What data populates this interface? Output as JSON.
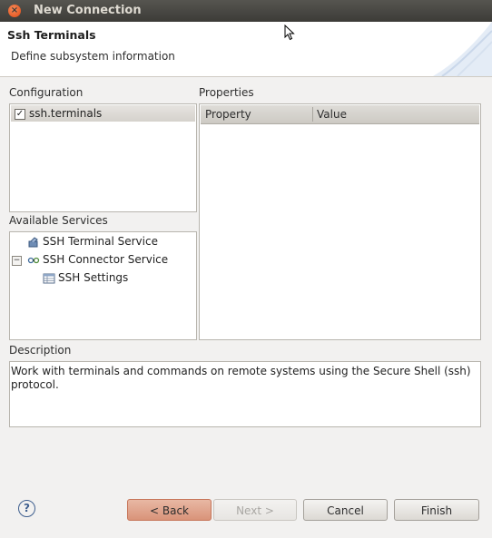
{
  "window": {
    "title": "New Connection"
  },
  "header": {
    "title": "Ssh Terminals",
    "subtitle": "Define subsystem information"
  },
  "configuration": {
    "label": "Configuration",
    "items": [
      {
        "label": "ssh.terminals",
        "checked": true
      }
    ]
  },
  "services": {
    "label": "Available Services",
    "items": [
      {
        "label": "SSH Terminal Service",
        "icon": "terminal-service-icon"
      },
      {
        "label": "SSH Connector Service",
        "icon": "connector-service-icon",
        "expanded": true
      },
      {
        "label": "SSH Settings",
        "icon": "settings-table-icon"
      }
    ]
  },
  "properties": {
    "label": "Properties",
    "columns": [
      "Property",
      "Value"
    ]
  },
  "description": {
    "label": "Description",
    "text": "Work with terminals and commands on remote systems using the Secure Shell (ssh) protocol."
  },
  "buttons": {
    "back": "< Back",
    "next": "Next >",
    "cancel": "Cancel",
    "finish": "Finish"
  },
  "colors": {
    "titlebar": "#3c3b37",
    "close": "#de4a14",
    "dialog_bg": "#f2f1f0"
  }
}
